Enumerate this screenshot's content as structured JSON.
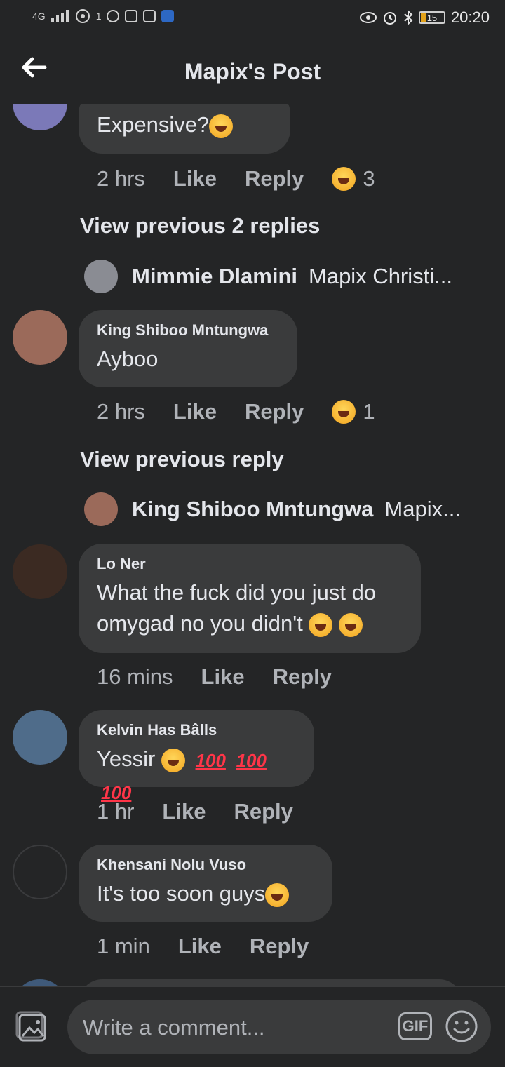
{
  "status_bar": {
    "network": "4G",
    "notification_count": "1",
    "battery": "15",
    "time": "20:20"
  },
  "header": {
    "title": "Mapix's Post"
  },
  "comments": [
    {
      "text": "Expensive?",
      "time": "2 hrs",
      "like": "Like",
      "reply": "Reply",
      "reaction_count": "3"
    },
    {
      "author": "King Shiboo Mntungwa",
      "text": "Ayboo",
      "time": "2 hrs",
      "like": "Like",
      "reply": "Reply",
      "reaction_count": "1"
    },
    {
      "author": "Lo Ner",
      "text_line1": "What the fuck did you just do",
      "text_line2": "omygad no you didn't",
      "time": "16 mins",
      "like": "Like",
      "reply": "Reply"
    },
    {
      "author": "Kelvin Has Bâlls",
      "text": "Yessir",
      "hundreds": [
        "100",
        "100",
        "100"
      ],
      "time": "1 hr",
      "like": "Like",
      "reply": "Reply"
    },
    {
      "author": "Khensani Nolu Vuso",
      "text": "It's too soon guys",
      "time": "1 min",
      "like": "Like",
      "reply": "Reply"
    }
  ],
  "view_previous": [
    {
      "label": "View previous 2 replies",
      "reply_name": "Mimmie Dlamini",
      "reply_text": "Mapix Christi..."
    },
    {
      "label": "View previous reply",
      "reply_name": "King Shiboo Mntungwa",
      "reply_text": "Mapix..."
    }
  ],
  "composer": {
    "placeholder": "Write a comment...",
    "gif": "GIF"
  },
  "icons": {
    "back": "arrow-left-icon",
    "photo": "photo-icon",
    "smile": "smiley-icon"
  }
}
